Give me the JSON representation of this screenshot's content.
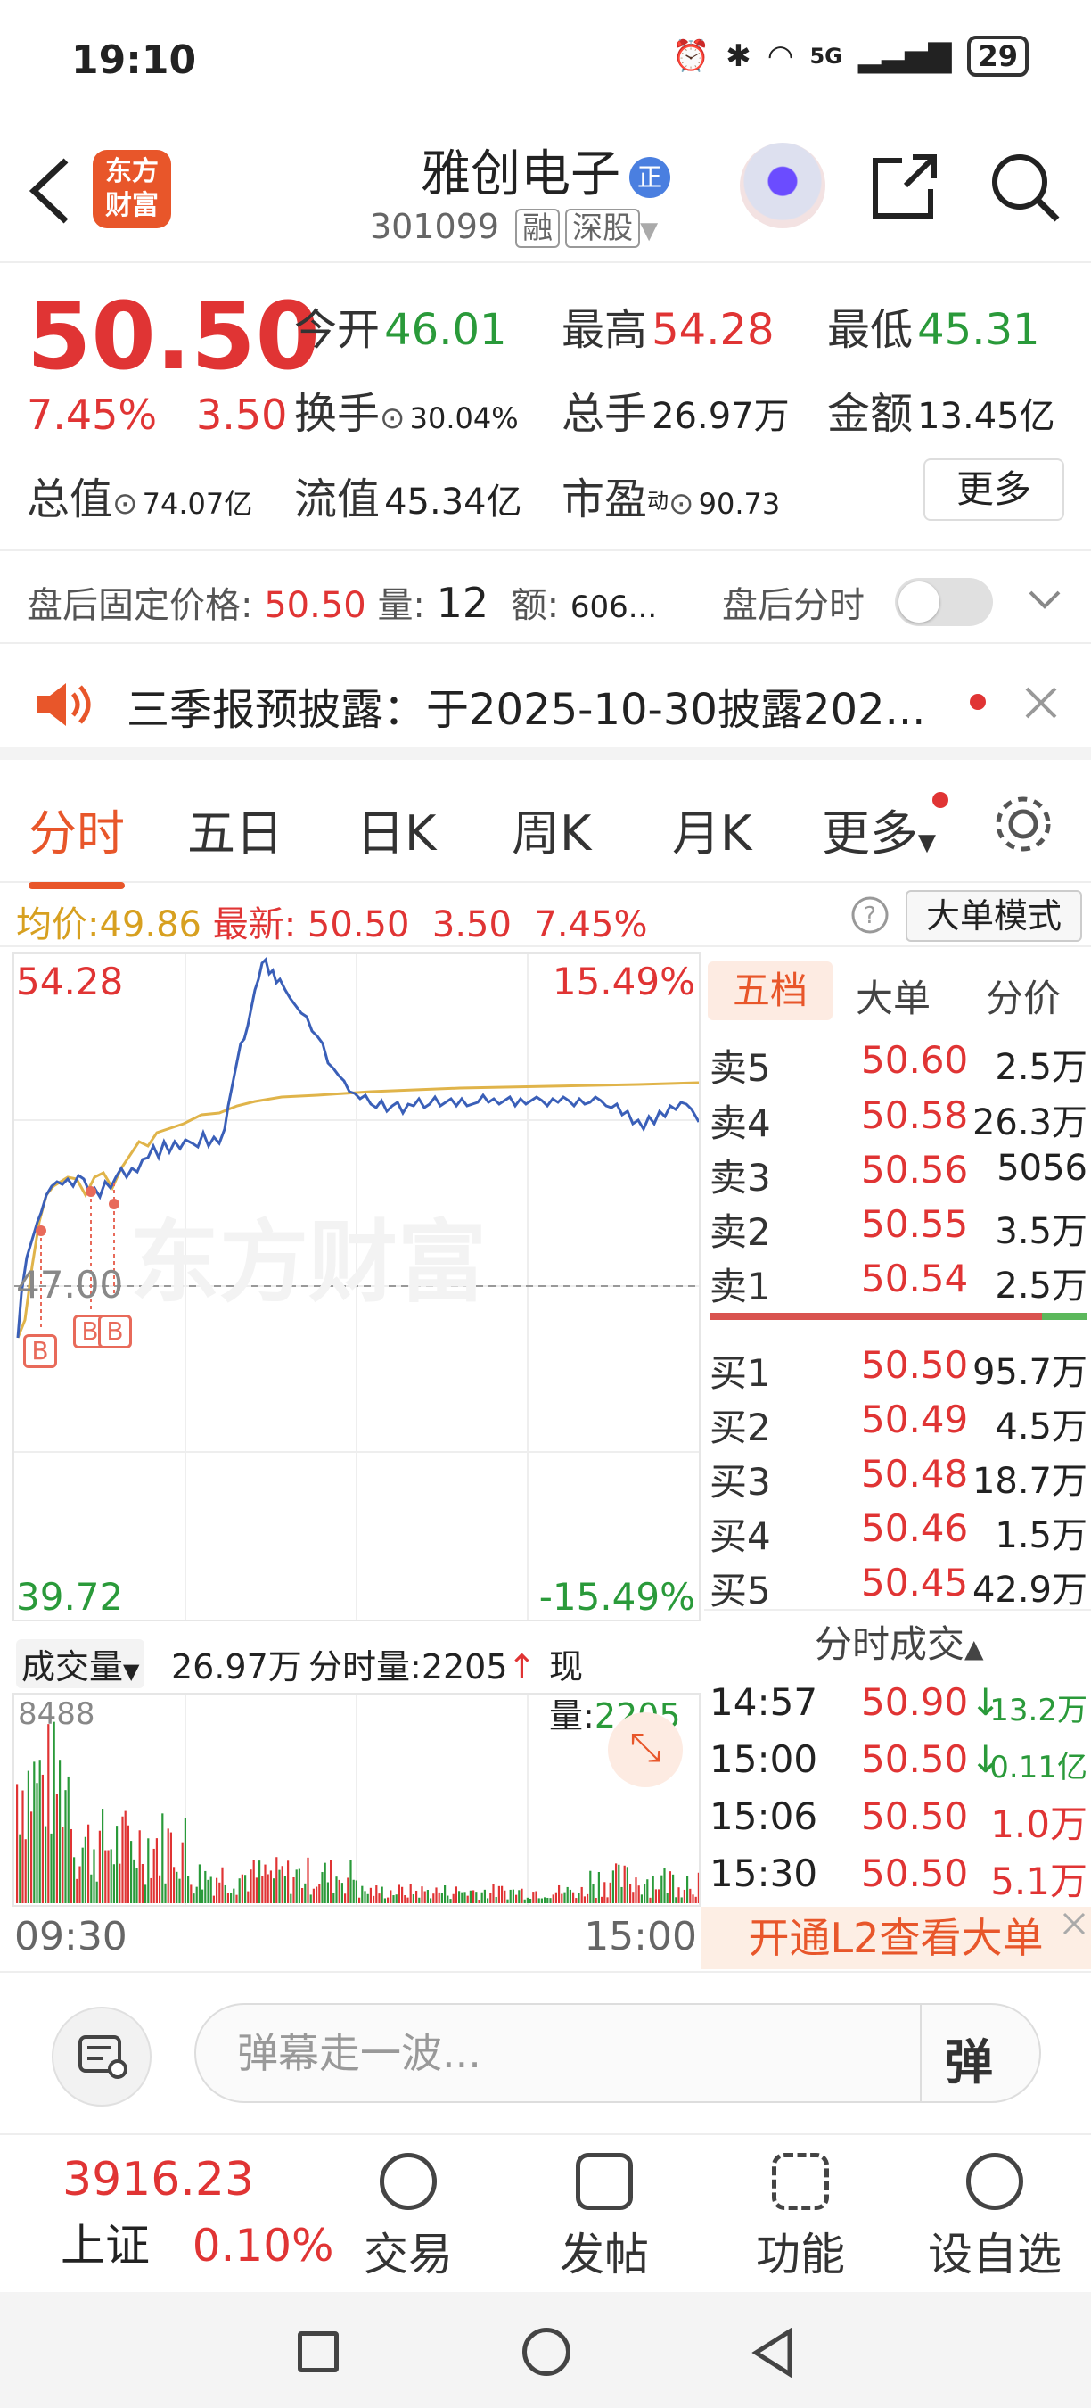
{
  "status": {
    "time": "19:10",
    "net": "5G",
    "battery": "29"
  },
  "header": {
    "logo_line1": "东方",
    "logo_line2": "财富",
    "stock_name": "雅创电子",
    "badge": "正",
    "code": "301099",
    "tag1": "融",
    "tag2": "深股"
  },
  "quote": {
    "price": "50.50",
    "pct": "7.45%",
    "chg": "3.50",
    "open_label": "今开",
    "open": "46.01",
    "high_label": "最高",
    "high": "54.28",
    "low_label": "最低",
    "low": "45.31",
    "turnover_label": "换手",
    "turnover": "30.04%",
    "volume_label": "总手",
    "volume": "26.97万",
    "amount_label": "金额",
    "amount": "13.45亿",
    "mktcap_label": "总值",
    "mktcap": "74.07亿",
    "float_label": "流值",
    "float": "45.34亿",
    "pe_label": "市盈",
    "pe_sup": "动",
    "pe": "90.73",
    "more": "更多"
  },
  "afterhours": {
    "label": "盘后固定价格:",
    "price": "50.50",
    "vol_label": "量:",
    "vol": "12",
    "amt_label": "额:",
    "amt": "606...",
    "toggle_label": "盘后分时"
  },
  "notice": {
    "text": "三季报预披露：于2025-10-30披露202..."
  },
  "tabs": [
    "分时",
    "五日",
    "日K",
    "周K",
    "月K",
    "更多"
  ],
  "infoline": {
    "avg_label": "均价:",
    "avg": "49.86",
    "last_label": "最新:",
    "last": "50.50",
    "chg": "3.50",
    "pct": "7.45%",
    "big_order_mode": "大单模式"
  },
  "chart": {
    "top_price": "54.28",
    "bottom_price": "39.72",
    "top_pct": "15.49%",
    "bottom_pct": "-15.49%",
    "mid_price": "47.00",
    "watermark": "东方财富",
    "buy_marker": "B"
  },
  "volume": {
    "label": "成交量",
    "total": "26.97万",
    "tick_label": "分时量:",
    "tick": "2205",
    "now_label": "现量:",
    "now": "2205",
    "max": "8488",
    "time_start": "09:30",
    "time_end": "15:00"
  },
  "book": {
    "tabs": [
      "五档",
      "大单",
      "分价"
    ],
    "asks": [
      {
        "label": "卖5",
        "price": "50.60",
        "vol": "2.5万"
      },
      {
        "label": "卖4",
        "price": "50.58",
        "vol": "26.3万"
      },
      {
        "label": "卖3",
        "price": "50.56",
        "vol": "5056"
      },
      {
        "label": "卖2",
        "price": "50.55",
        "vol": "3.5万"
      },
      {
        "label": "卖1",
        "price": "50.54",
        "vol": "2.5万"
      }
    ],
    "bids": [
      {
        "label": "买1",
        "price": "50.50",
        "vol": "95.7万"
      },
      {
        "label": "买2",
        "price": "50.49",
        "vol": "4.5万"
      },
      {
        "label": "买3",
        "price": "50.48",
        "vol": "18.7万"
      },
      {
        "label": "买4",
        "price": "50.46",
        "vol": "1.5万"
      },
      {
        "label": "买5",
        "price": "50.45",
        "vol": "42.9万"
      }
    ],
    "trades_title": "分时成交",
    "trades": [
      {
        "time": "14:57",
        "price": "50.90",
        "arrow": "↓",
        "vol": "13.2万"
      },
      {
        "time": "15:00",
        "price": "50.50",
        "arrow": "↓",
        "vol": "0.11亿"
      },
      {
        "time": "15:06",
        "price": "50.50",
        "arrow": "",
        "vol": "1.0万"
      },
      {
        "time": "15:30",
        "price": "50.50",
        "arrow": "",
        "vol": "5.1万"
      }
    ],
    "l2_banner": "开通L2查看大单"
  },
  "danmu": {
    "placeholder": "弹幕走一波...",
    "send": "弹"
  },
  "bottomnav": {
    "index_value": "3916.23",
    "index_name": "上证",
    "index_pct": "0.10%",
    "items": [
      "交易",
      "发帖",
      "功能",
      "设自选"
    ]
  }
}
